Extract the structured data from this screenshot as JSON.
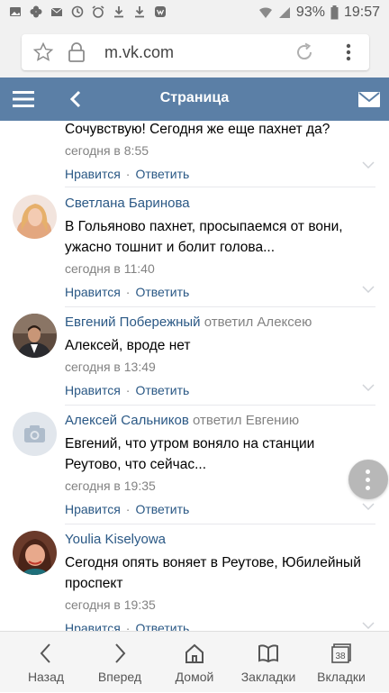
{
  "status_bar": {
    "battery": "93%",
    "time": "19:57",
    "icons": [
      "photo-icon",
      "flower-icon",
      "mail-icon",
      "sync-icon",
      "alarm-icon",
      "download-icon",
      "download-icon",
      "vk-icon",
      "wifi-icon",
      "signal-icon",
      "battery-icon"
    ]
  },
  "browser": {
    "url": "m.vk.com"
  },
  "header": {
    "title": "Страница",
    "colors": {
      "background": "#5b7fa6"
    }
  },
  "comments": [
    {
      "author": "",
      "reply_to": "",
      "text": "Сочувствую! Сегодня же еще пахнет да?",
      "date": "сегодня в 8:55",
      "like": "Нравится",
      "reply": "Ответить"
    },
    {
      "author": "Светлана Баринова",
      "reply_to": "",
      "text": "В Гольяново пахнет, просыпаемся от вони, ужасно тошнит и болит голова...",
      "date": "сегодня в 11:40",
      "like": "Нравится",
      "reply": "Ответить"
    },
    {
      "author": "Евгений Побережный",
      "reply_to": "ответил Алексею",
      "text": "Алексей, вроде нет",
      "date": "сегодня в 13:49",
      "like": "Нравится",
      "reply": "Ответить"
    },
    {
      "author": "Алексей Сальников",
      "reply_to": "ответил Евгению",
      "text": "Евгений, что утром воняло на станции Реутово, что сейчас...",
      "date": "сегодня в 19:35",
      "like": "Нравится",
      "reply": "Ответить"
    },
    {
      "author": "Youlia Kiselyowa",
      "reply_to": "",
      "text": "Сегодня опять воняет в Реутове, Юбилейный проспект",
      "date": "сегодня в 19:35",
      "like": "Нравится",
      "reply": "Ответить"
    }
  ],
  "bottom_nav": {
    "back": "Назад",
    "forward": "Вперед",
    "home": "Домой",
    "bookmarks": "Закладки",
    "tabs": "Вкладки",
    "tab_count": "38"
  },
  "colors": {
    "link": "#2a5885",
    "muted": "#828282"
  }
}
